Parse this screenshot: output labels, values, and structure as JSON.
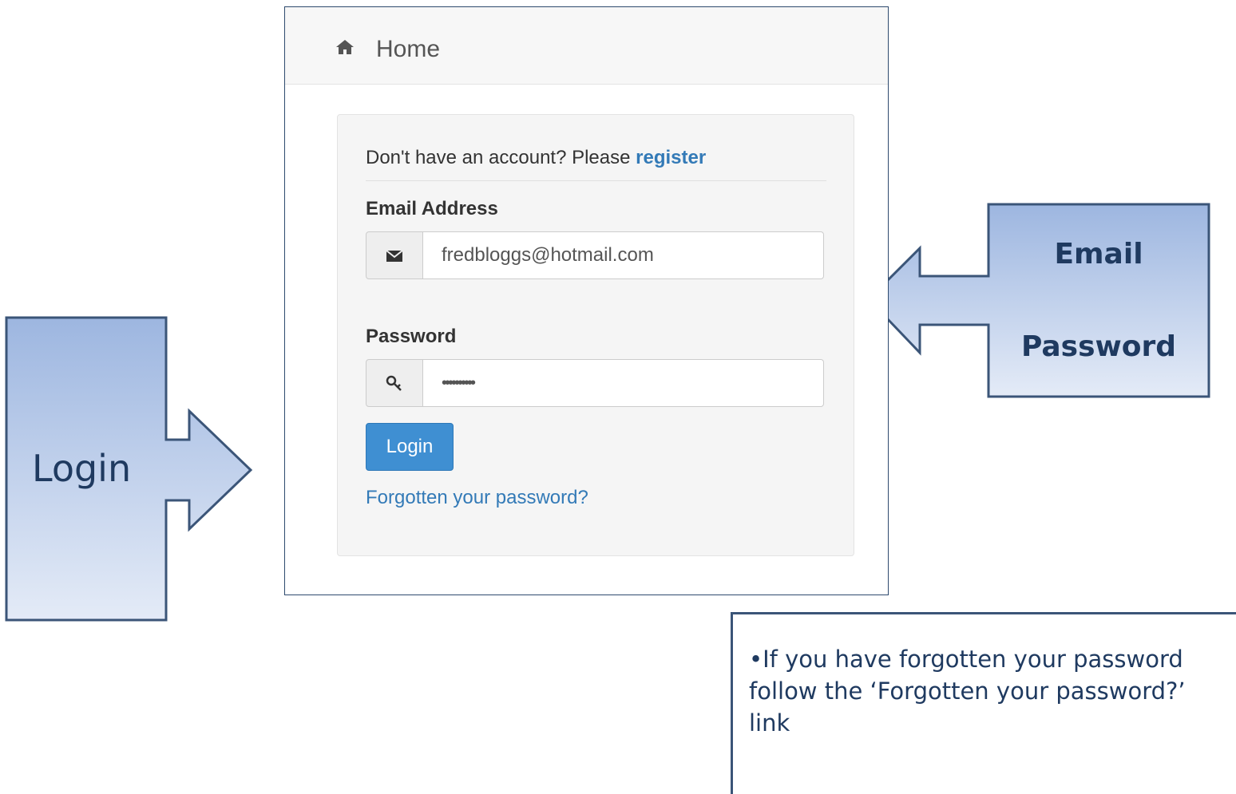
{
  "nav": {
    "home_label": "Home",
    "home_icon": "home-icon"
  },
  "login_form": {
    "register_prompt": "Don't have an account? Please",
    "register_link": "register",
    "email": {
      "label": "Email Address",
      "icon": "envelope-icon",
      "value": "fredbloggs@hotmail.com"
    },
    "password": {
      "label": "Password",
      "icon": "key-icon",
      "value": "••••••••••"
    },
    "login_button": "Login",
    "forgot_link": "Forgotten your password?"
  },
  "callouts": {
    "login_arrow": "Login",
    "email_arrow_line1": "Email",
    "email_arrow_line2": "Password",
    "note": "•If you have forgotten your password follow the ‘Forgotten your password?’ link"
  },
  "colors": {
    "callout_fill_top": "#9db6e0",
    "callout_fill_bottom": "#e4ebf7",
    "callout_border": "#3b5578",
    "callout_text": "#1f3a60",
    "link": "#337ab7",
    "button": "#3f8fd2"
  }
}
